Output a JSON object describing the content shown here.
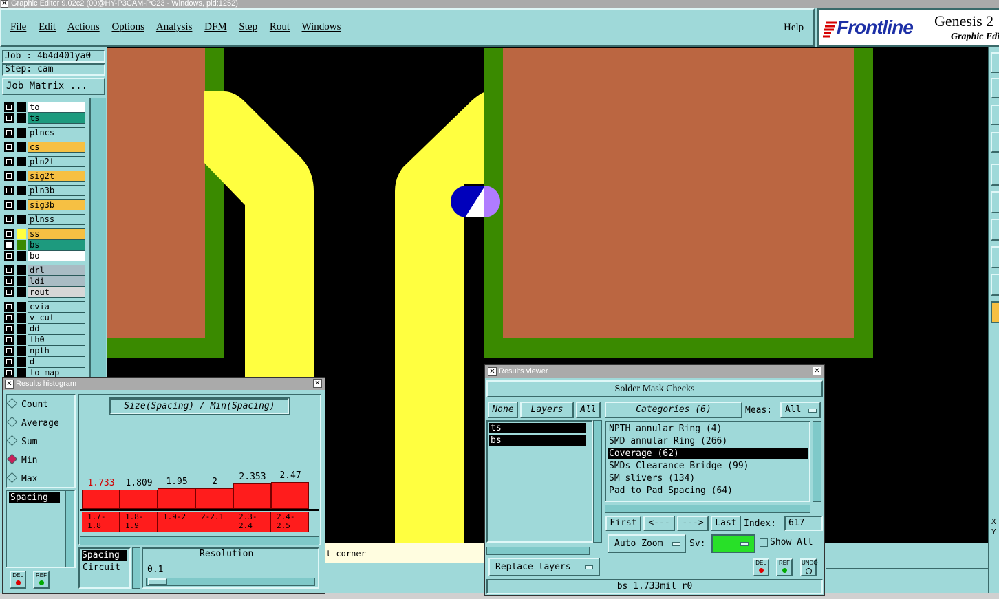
{
  "window": {
    "title": "Graphic Editor 9.02c2 (00@HY-P3CAM-PC23 - Windows, pid:1252)"
  },
  "menu": {
    "items": [
      "File",
      "Edit",
      "Actions",
      "Options",
      "Analysis",
      "DFM",
      "Step",
      "Rout",
      "Windows"
    ],
    "help": "Help"
  },
  "brand": {
    "logo": "Frontline",
    "product": "Genesis 2",
    "subtitle": "Graphic Edi"
  },
  "job": {
    "job_label": "Job : 4b4d401ya0",
    "step_label": "Step: cam",
    "matrix_button": "Job Matrix ..."
  },
  "layers": [
    {
      "name": "to",
      "color": "#ffffff",
      "swatch": "#000000"
    },
    {
      "name": "ts",
      "color": "#1d9a7e",
      "swatch": "#000000"
    },
    {
      "name": "plncs",
      "color": "#9fd9d9",
      "swatch": "#000000"
    },
    {
      "name": "cs",
      "color": "#f6c043",
      "swatch": "#000000"
    },
    {
      "name": "pln2t",
      "color": "#9fd9d9",
      "swatch": "#000000"
    },
    {
      "name": "sig2t",
      "color": "#f6c043",
      "swatch": "#000000"
    },
    {
      "name": "pln3b",
      "color": "#9fd9d9",
      "swatch": "#000000"
    },
    {
      "name": "sig3b",
      "color": "#f6c043",
      "swatch": "#000000"
    },
    {
      "name": "plnss",
      "color": "#9fd9d9",
      "swatch": "#000000"
    },
    {
      "name": "ss",
      "color": "#f6c043",
      "swatch": "#ffff40"
    },
    {
      "name": "bs",
      "color": "#1d9a7e",
      "swatch": "#3a8a00"
    },
    {
      "name": "bo",
      "color": "#ffffff",
      "swatch": "#000000"
    },
    {
      "name": "drl",
      "color": "#a9bcc4",
      "swatch": "#000000"
    },
    {
      "name": "ldi",
      "color": "#a9bcc4",
      "swatch": "#000000"
    },
    {
      "name": "rout",
      "color": "#d7d7d7",
      "swatch": "#000000"
    },
    {
      "name": "cvia",
      "color": "#9fd9d9",
      "swatch": "#000000"
    },
    {
      "name": "v-cut",
      "color": "#9fd9d9",
      "swatch": "#000000"
    },
    {
      "name": "dd",
      "color": "#9fd9d9",
      "swatch": "#000000"
    },
    {
      "name": "th0",
      "color": "#9fd9d9",
      "swatch": "#000000"
    },
    {
      "name": "npth",
      "color": "#9fd9d9",
      "swatch": "#000000"
    },
    {
      "name": "d",
      "color": "#9fd9d9",
      "swatch": "#000000"
    },
    {
      "name": "to_map",
      "color": "#9fd9d9",
      "swatch": "#000000"
    }
  ],
  "histogram": {
    "title": "Results histogram",
    "header": "Size(Spacing) / Min(Spacing)",
    "modes": [
      "Count",
      "Average",
      "Sum",
      "Min",
      "Max"
    ],
    "selected_mode": "Min",
    "list_item": "Spacing",
    "bars": [
      {
        "value": "1.733",
        "bin": "1.7-1.8",
        "fill": 0.72,
        "highlight": true
      },
      {
        "value": "1.809",
        "bin": "1.8-1.9",
        "fill": 0.72,
        "highlight": false
      },
      {
        "value": "1.95",
        "bin": "1.9-2",
        "fill": 0.75,
        "highlight": false
      },
      {
        "value": "2",
        "bin": "2-2.1",
        "fill": 0.75,
        "highlight": false
      },
      {
        "value": "2.353",
        "bin": "2.3-2.4",
        "fill": 0.9,
        "highlight": false
      },
      {
        "value": "2.47",
        "bin": "2.4-2.5",
        "fill": 0.93,
        "highlight": false
      }
    ],
    "options": [
      "Spacing",
      "Circuit"
    ],
    "resolution_label": "Resolution",
    "resolution_value": "0.1",
    "del": "DEL",
    "ref": "REF"
  },
  "results": {
    "title": "Results viewer",
    "header": "Solder Mask Checks",
    "none_btn": "None",
    "layers_btn": "Layers",
    "all_btn": "All",
    "layer_items": [
      "ts",
      "bs"
    ],
    "categories_btn": "Categories (6)",
    "meas_label": "Meas:",
    "meas_value": "All",
    "categories": [
      "NPTH annular Ring (4)",
      "SMD annular Ring (266)",
      "Coverage (62)",
      "SMDs Clearance Bridge (99)",
      "SM slivers (134)",
      "Pad to Pad Spacing (64)"
    ],
    "selected_category": "Coverage (62)",
    "first": "First",
    "prev": "<---",
    "next": "--->",
    "last": "Last",
    "index_label": "Index:",
    "index_value": "617",
    "auto_zoom": "Auto Zoom",
    "sv_label": "Sv:",
    "show_all": "Show All",
    "replace_layers": "Replace layers",
    "status": "bs 1.733mil  r0",
    "del": "DEL",
    "ref": "REF",
    "undo": "UNDO"
  },
  "statusbar": {
    "hint": "t corner"
  },
  "right_toolbar": {
    "coords": [
      "X",
      "Y"
    ]
  },
  "colors": {
    "copper": "#bb6641",
    "mask_green": "#3a8a00",
    "trace_yellow": "#ffff40",
    "pad_blue": "#0000bb",
    "pad_violet": "#b07cff",
    "panel": "#9fd9d9",
    "bar_red": "#ff1c1c"
  }
}
